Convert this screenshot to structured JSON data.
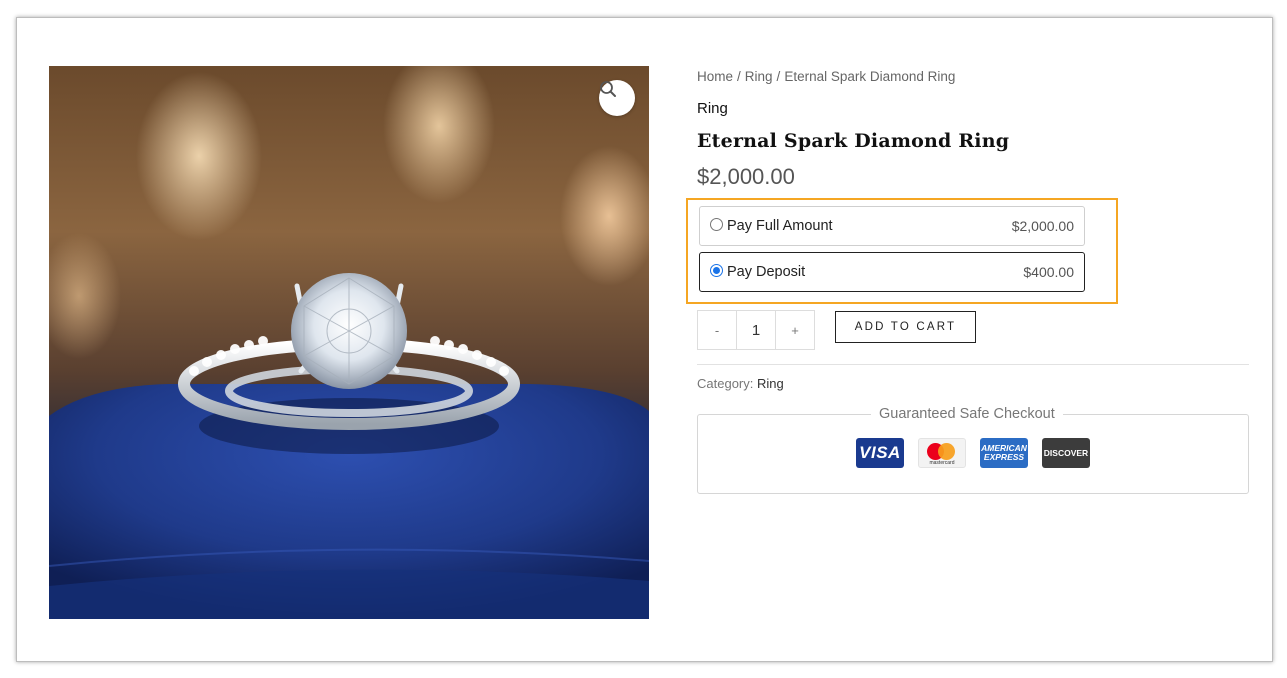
{
  "breadcrumb": {
    "items": [
      "Home",
      "Ring",
      "Eternal Spark Diamond Ring"
    ],
    "separator": "/"
  },
  "product": {
    "category_label": "Ring",
    "title": "Eternal Spark Diamond Ring",
    "price": "$2,000.00",
    "image_icon": "diamond-ring-photo"
  },
  "payment_options": [
    {
      "label": "Pay Full Amount",
      "price": "$2,000.00",
      "selected": false
    },
    {
      "label": "Pay Deposit",
      "price": "$400.00",
      "selected": true
    }
  ],
  "quantity": {
    "minus": "-",
    "value": "1",
    "plus": "+"
  },
  "add_to_cart_label": "ADD TO CART",
  "category": {
    "prefix": "Category:",
    "value": "Ring"
  },
  "safe_checkout": {
    "title": "Guaranteed Safe Checkout",
    "cards": [
      "VISA",
      "mastercard",
      "AMERICAN EXPRESS",
      "DISCOVER"
    ]
  },
  "colors": {
    "highlight_border": "#f5a623",
    "radio_accent": "#1a73e8",
    "pillow_blue": "#1f3a8a"
  },
  "icons": {
    "zoom": "zoom-icon"
  }
}
